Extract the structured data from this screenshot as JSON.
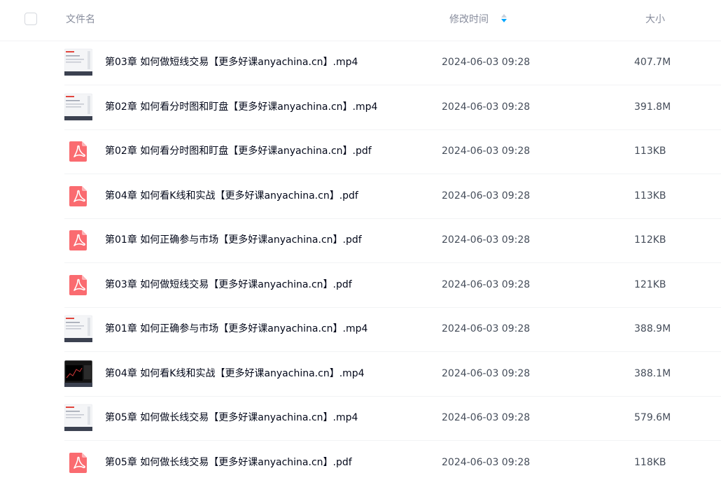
{
  "header": {
    "name_label": "文件名",
    "time_label": "修改时间",
    "size_label": "大小"
  },
  "colors": {
    "accent": "#06a7ff",
    "pdf": "#fa6b70"
  },
  "files": [
    {
      "name": "第03章 如何做短线交易【更多好课anyachina.cn】.mp4",
      "time": "2024-06-03 09:28",
      "size": "407.7M",
      "icon": "video-thumbnail"
    },
    {
      "name": "第02章 如何看分时图和盯盘【更多好课anyachina.cn】.mp4",
      "time": "2024-06-03 09:28",
      "size": "391.8M",
      "icon": "video-thumbnail"
    },
    {
      "name": "第02章 如何看分时图和盯盘【更多好课anyachina.cn】.pdf",
      "time": "2024-06-03 09:28",
      "size": "113KB",
      "icon": "pdf-icon"
    },
    {
      "name": "第04章 如何看K线和实战【更多好课anyachina.cn】.pdf",
      "time": "2024-06-03 09:28",
      "size": "113KB",
      "icon": "pdf-icon"
    },
    {
      "name": "第01章 如何正确参与市场【更多好课anyachina.cn】.pdf",
      "time": "2024-06-03 09:28",
      "size": "112KB",
      "icon": "pdf-icon"
    },
    {
      "name": "第03章 如何做短线交易【更多好课anyachina.cn】.pdf",
      "time": "2024-06-03 09:28",
      "size": "121KB",
      "icon": "pdf-icon"
    },
    {
      "name": "第01章 如何正确参与市场【更多好课anyachina.cn】.mp4",
      "time": "2024-06-03 09:28",
      "size": "388.9M",
      "icon": "video-thumbnail"
    },
    {
      "name": "第04章 如何看K线和实战【更多好课anyachina.cn】.mp4",
      "time": "2024-06-03 09:28",
      "size": "388.1M",
      "icon": "video-thumbnail"
    },
    {
      "name": "第05章 如何做长线交易【更多好课anyachina.cn】.mp4",
      "time": "2024-06-03 09:28",
      "size": "579.6M",
      "icon": "video-thumbnail"
    },
    {
      "name": "第05章 如何做长线交易【更多好课anyachina.cn】.pdf",
      "time": "2024-06-03 09:28",
      "size": "118KB",
      "icon": "pdf-icon"
    }
  ]
}
